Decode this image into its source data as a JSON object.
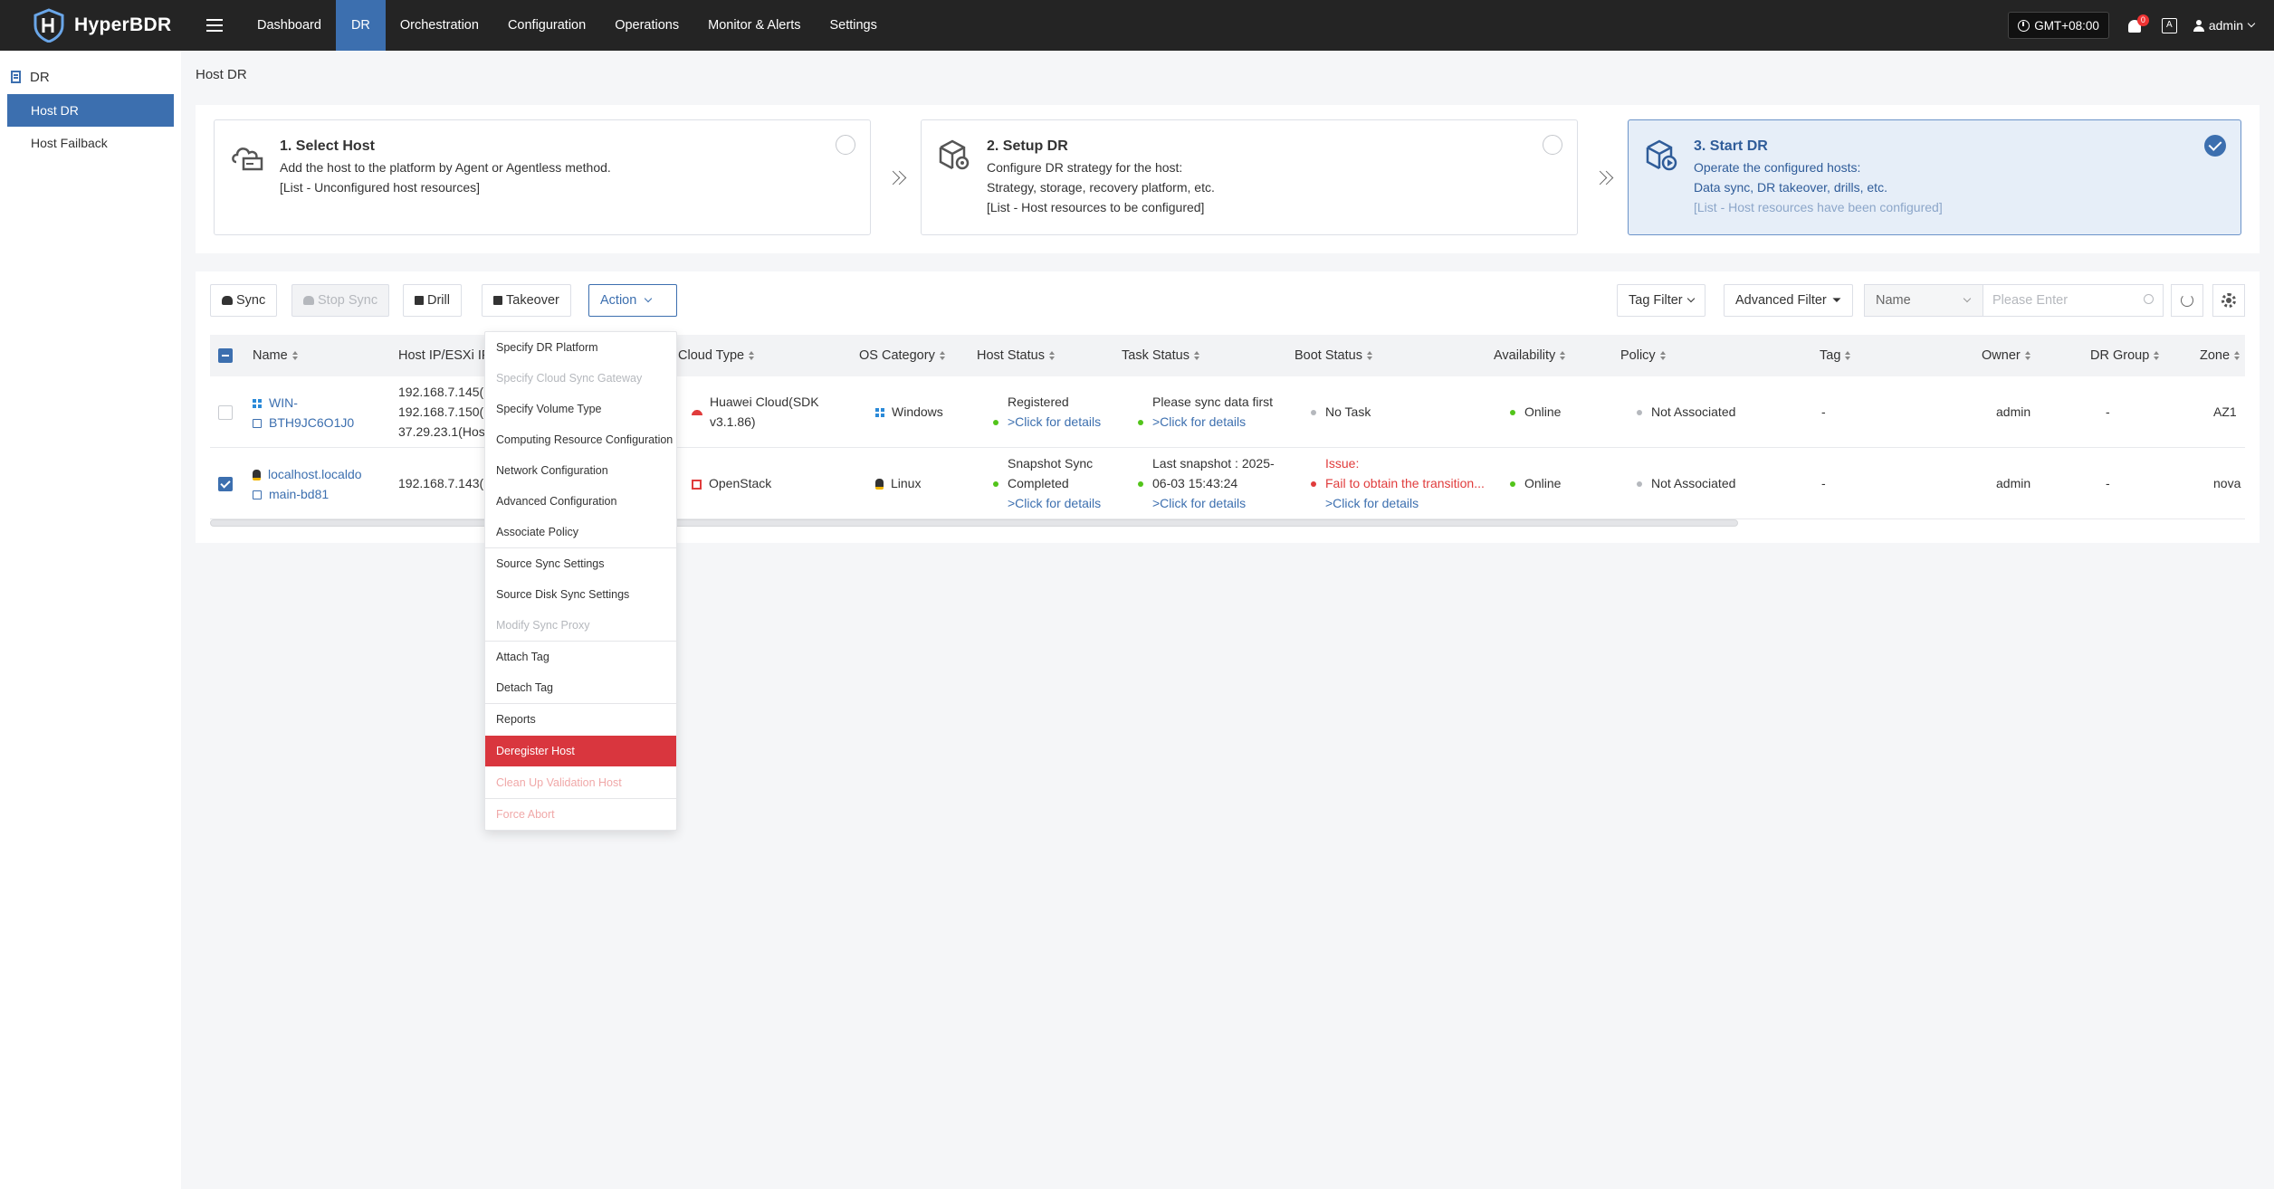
{
  "app": {
    "name": "HyperBDR"
  },
  "nav": [
    "Dashboard",
    "DR",
    "Orchestration",
    "Configuration",
    "Operations",
    "Monitor & Alerts",
    "Settings"
  ],
  "topbar": {
    "timezone": "GMT+08:00",
    "notifications": "0",
    "lang": "A",
    "user": "admin"
  },
  "sidebar": {
    "section": "DR",
    "items": [
      "Host DR",
      "Host Failback"
    ]
  },
  "page": {
    "title": "Host DR"
  },
  "steps": [
    {
      "title": "1. Select Host",
      "lines": [
        "Add the host to the platform by Agent or Agentless method.",
        "[List - Unconfigured host resources]"
      ]
    },
    {
      "title": "2. Setup DR",
      "lines": [
        "Configure DR strategy for the host:",
        "Strategy, storage, recovery platform, etc.",
        "[List - Host resources to be configured]"
      ]
    },
    {
      "title": "3. Start DR",
      "lines": [
        "Operate the configured hosts:",
        "Data sync, DR takeover, drills, etc.",
        "[List - Host resources have been configured]"
      ]
    }
  ],
  "toolbar": {
    "sync": "Sync",
    "stop_sync": "Stop Sync",
    "drill": "Drill",
    "takeover": "Takeover",
    "action": "Action",
    "tag_filter": "Tag Filter",
    "advanced_filter": "Advanced Filter",
    "search_field": "Name",
    "search_placeholder": "Please Enter"
  },
  "columns": [
    "Name",
    "Host IP/ESXi IP",
    "Cloud Type",
    "OS Category",
    "Host Status",
    "Task Status",
    "Boot Status",
    "Availability",
    "Policy",
    "Tag",
    "Owner",
    "DR Group",
    "Zone"
  ],
  "rows": [
    {
      "name": [
        "WIN-",
        "BTH9JC6O1J0"
      ],
      "ips": [
        "192.168.7.145(H",
        "192.168.7.150(H",
        "37.29.23.1(Host"
      ],
      "cloud": [
        "Huawei Cloud(SDK",
        "v3.1.86)"
      ],
      "os": "Windows",
      "host_status": "Registered",
      "host_status_link": ">Click for details",
      "task_status": "Please sync data first",
      "task_status_link": ">Click for details",
      "boot_status": "No Task",
      "availability": "Online",
      "policy": "Not Associated",
      "tag": "-",
      "owner": "admin",
      "group": "-",
      "zone": "AZ1"
    },
    {
      "name": [
        "localhost.localdo",
        "main-bd81"
      ],
      "ips": [
        "192.168.7.143(H"
      ],
      "cloud": [
        "OpenStack"
      ],
      "os": "Linux",
      "host_status": "Snapshot Sync",
      "host_status_2": "Completed",
      "host_status_link": ">Click for details",
      "task_status": "Last snapshot : 2025-",
      "task_status_2": "06-03 15:43:24",
      "task_status_link": ">Click for details",
      "boot_status": "Issue:",
      "boot_status_2": "Fail to obtain the transition...",
      "boot_status_link": ">Click for details",
      "availability": "Online",
      "policy": "Not Associated",
      "tag": "-",
      "owner": "admin",
      "group": "-",
      "zone": "nova"
    }
  ],
  "action_menu": [
    "Specify DR Platform",
    "Specify Cloud Sync Gateway",
    "Specify Volume Type",
    "Computing Resource Configuration",
    "Network Configuration",
    "Advanced Configuration",
    "Associate Policy",
    "Source Sync Settings",
    "Source Disk Sync Settings",
    "Modify Sync Proxy",
    "Attach Tag",
    "Detach Tag",
    "Reports",
    "Deregister Host",
    "Clean Up Validation Host",
    "Force Abort"
  ]
}
